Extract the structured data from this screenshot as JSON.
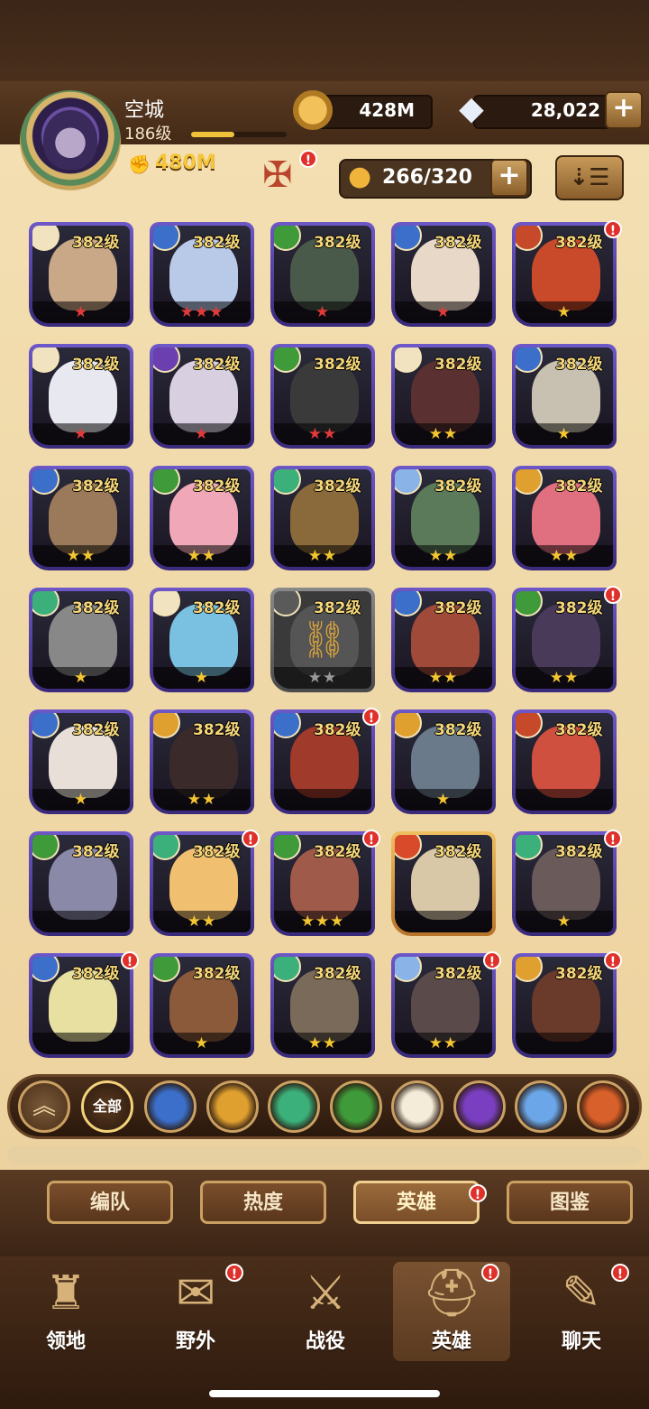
{
  "player": {
    "name": "空城",
    "level": "186级",
    "power": "480M",
    "xp_fraction": 0.45
  },
  "resources": {
    "gold": "428M",
    "gems": "28,022"
  },
  "roster": {
    "count": "266/320"
  },
  "icons": {
    "power": "fist-icon",
    "gold": "gold-coin-icon",
    "gems": "diamond-icon",
    "roster": "person-icon",
    "sort": "sort-icon"
  },
  "heroes": [
    {
      "level": "382级",
      "stars": "★",
      "star_color": "red",
      "faction": "light",
      "badge": false
    },
    {
      "level": "382级",
      "stars": "★★★",
      "star_color": "red",
      "faction": "lightbearer",
      "badge": false
    },
    {
      "level": "382级",
      "stars": "★",
      "star_color": "red",
      "faction": "graveborn",
      "badge": false
    },
    {
      "level": "382级",
      "stars": "★",
      "star_color": "red",
      "faction": "lightbearer",
      "badge": false
    },
    {
      "level": "382级",
      "stars": "★",
      "star_color": "gold",
      "faction": "hypogean",
      "badge": true
    },
    {
      "level": "382级",
      "stars": "★",
      "star_color": "red",
      "faction": "light",
      "badge": false
    },
    {
      "level": "382级",
      "stars": "★",
      "star_color": "red",
      "faction": "mauler-dark",
      "badge": false
    },
    {
      "level": "382级",
      "stars": "★★",
      "star_color": "red",
      "faction": "graveborn",
      "badge": false
    },
    {
      "level": "382级",
      "stars": "★★",
      "star_color": "gold",
      "faction": "light",
      "badge": false
    },
    {
      "level": "382级",
      "stars": "★",
      "star_color": "gold",
      "faction": "lightbearer",
      "badge": false
    },
    {
      "level": "382级",
      "stars": "★★",
      "star_color": "gold",
      "faction": "lightbearer",
      "badge": false
    },
    {
      "level": "382级",
      "stars": "★★",
      "star_color": "gold",
      "faction": "graveborn",
      "badge": false
    },
    {
      "level": "382级",
      "stars": "★★",
      "star_color": "gold",
      "faction": "wilder",
      "badge": false
    },
    {
      "level": "382级",
      "stars": "★★",
      "star_color": "gold",
      "faction": "celestial",
      "badge": false
    },
    {
      "level": "382级",
      "stars": "★★",
      "star_color": "gold",
      "faction": "mauler",
      "badge": false
    },
    {
      "level": "382级",
      "stars": "★",
      "star_color": "gold",
      "faction": "wilder",
      "badge": false
    },
    {
      "level": "382级",
      "stars": "★",
      "star_color": "gold",
      "faction": "light",
      "badge": false
    },
    {
      "level": "382级",
      "stars": "★★",
      "star_color": "grayc",
      "faction": "locked",
      "badge": false,
      "locked": true
    },
    {
      "level": "382级",
      "stars": "★★",
      "star_color": "gold",
      "faction": "lightbearer",
      "badge": false
    },
    {
      "level": "382级",
      "stars": "★★",
      "star_color": "gold",
      "faction": "graveborn",
      "badge": true
    },
    {
      "level": "382级",
      "stars": "★",
      "star_color": "gold",
      "faction": "lightbearer",
      "badge": false
    },
    {
      "level": "382级",
      "stars": "★★",
      "star_color": "gold",
      "faction": "mauler",
      "badge": false
    },
    {
      "level": "382级",
      "stars": "",
      "star_color": "gold",
      "faction": "lightbearer",
      "badge": true
    },
    {
      "level": "382级",
      "stars": "★",
      "star_color": "gold",
      "faction": "mauler",
      "badge": false
    },
    {
      "level": "382级",
      "stars": "",
      "star_color": "gold",
      "faction": "hypogean",
      "badge": false
    },
    {
      "level": "382级",
      "stars": "",
      "star_color": "gold",
      "faction": "graveborn",
      "badge": false
    },
    {
      "level": "382级",
      "stars": "★★",
      "star_color": "gold",
      "faction": "wilder",
      "badge": true
    },
    {
      "level": "382级",
      "stars": "★★★",
      "star_color": "gold",
      "faction": "graveborn",
      "badge": true
    },
    {
      "level": "382级",
      "stars": "",
      "star_color": "gold",
      "faction": "dimensional",
      "badge": false,
      "gold_frame": true
    },
    {
      "level": "382级",
      "stars": "★",
      "star_color": "gold",
      "faction": "wilder",
      "badge": true
    },
    {
      "level": "382级",
      "stars": "",
      "star_color": "gold",
      "faction": "lightbearer",
      "badge": true
    },
    {
      "level": "382级",
      "stars": "★",
      "star_color": "gold",
      "faction": "graveborn",
      "badge": false
    },
    {
      "level": "382级",
      "stars": "★★",
      "star_color": "gold",
      "faction": "wilder",
      "badge": false
    },
    {
      "level": "382级",
      "stars": "★★",
      "star_color": "gold",
      "faction": "celestial",
      "badge": true
    },
    {
      "level": "382级",
      "stars": "",
      "star_color": "gold",
      "faction": "mauler",
      "badge": true
    }
  ],
  "faction_colors": {
    "light": "#f2e3c0",
    "lightbearer": "#3b6fc9",
    "graveborn": "#3f9a3a",
    "hypogean": "#c64a2a",
    "mauler-dark": "#6b3fb0",
    "wilder": "#3bb07a",
    "celestial": "#8ab4e8",
    "mauler": "#e0a030",
    "dimensional": "#d84a2a",
    "locked": "#5a5a5a"
  },
  "filters": {
    "up_icon": "chevron-up-icon",
    "all_label": "全部",
    "items": [
      {
        "name": "lightbearer-icon",
        "color": "#3b6fc9"
      },
      {
        "name": "mauler-icon",
        "color": "#e0a030"
      },
      {
        "name": "wilder-icon",
        "color": "#3bb07a"
      },
      {
        "name": "graveborn-icon",
        "color": "#3f9a3a"
      },
      {
        "name": "celestial-icon",
        "color": "#f4ecd8"
      },
      {
        "name": "hypogean-icon",
        "color": "#7a3fc0"
      },
      {
        "name": "dimensional-icon",
        "color": "#6aa6e8"
      },
      {
        "name": "dimensional-fire-icon",
        "color": "#d8602a"
      }
    ]
  },
  "subtabs": [
    "编队",
    "热度",
    "英雄",
    "图鉴"
  ],
  "nav": [
    {
      "label": "领地",
      "icon": "castle-icon",
      "badge": false
    },
    {
      "label": "野外",
      "icon": "map-scroll-icon",
      "badge": true
    },
    {
      "label": "战役",
      "icon": "sword-shield-icon",
      "badge": false
    },
    {
      "label": "英雄",
      "icon": "hero-helmet-icon",
      "badge": true
    },
    {
      "label": "聊天",
      "icon": "chat-bubble-icon",
      "badge": true
    }
  ]
}
